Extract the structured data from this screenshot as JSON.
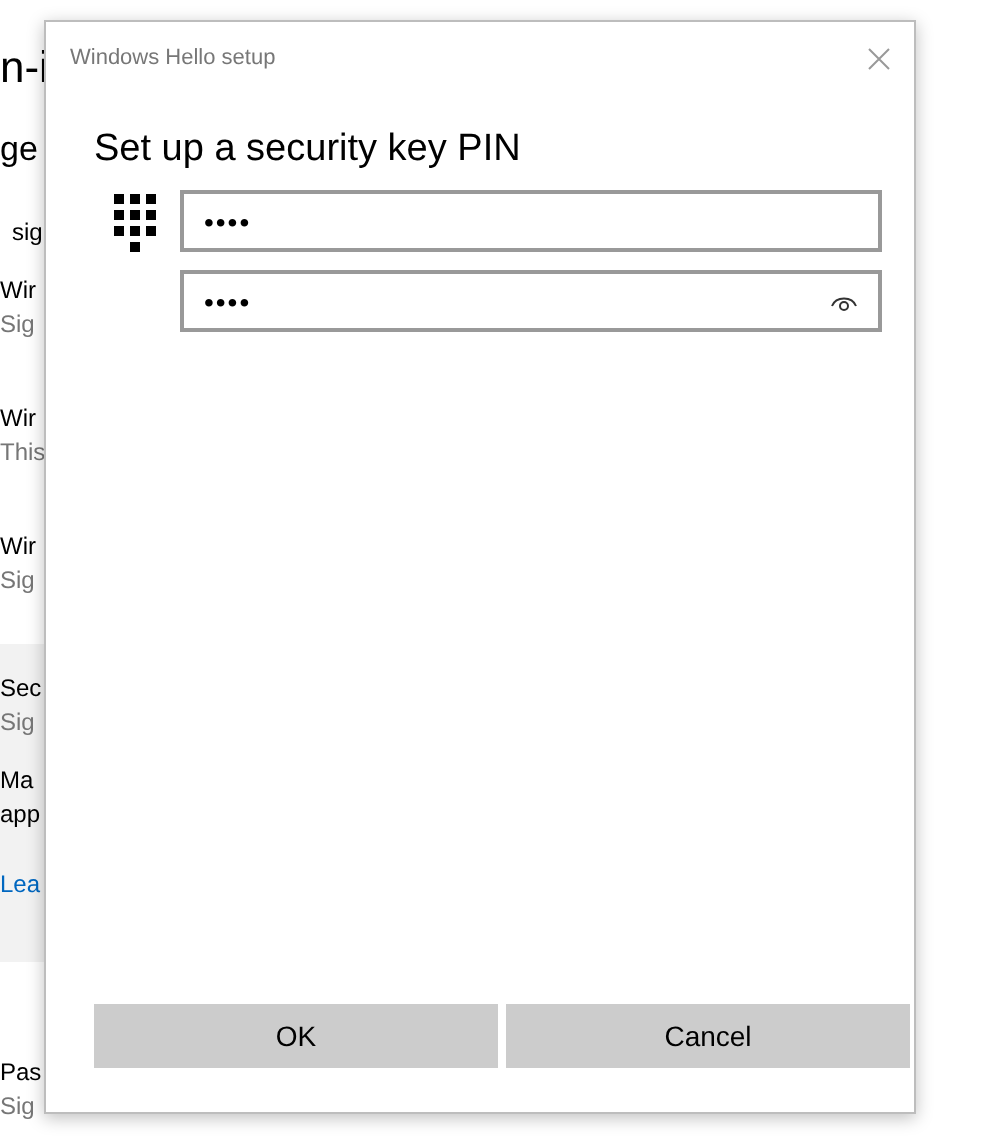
{
  "background_page": {
    "title": "n-i",
    "subtitle": "ge",
    "intro": "sig",
    "items": [
      {
        "title": "Wir",
        "description": "Sig",
        "highlighted": false
      },
      {
        "title": "Wir",
        "description": "This",
        "highlighted": false
      },
      {
        "title": "Wir",
        "description": "Sig",
        "highlighted": false
      },
      {
        "title": "Sec",
        "description": "Sig",
        "highlighted": true,
        "details": "Ma\napp",
        "link": "Lea"
      },
      {
        "title": "Pas",
        "description": "Sig",
        "highlighted": false
      }
    ]
  },
  "dialog": {
    "title": "Windows Hello setup",
    "heading": "Set up a security key PIN",
    "fields": [
      {
        "value": "••••",
        "reveal_button": false
      },
      {
        "value": "••••",
        "reveal_button": true
      }
    ],
    "buttons": [
      "OK",
      "Cancel"
    ]
  }
}
